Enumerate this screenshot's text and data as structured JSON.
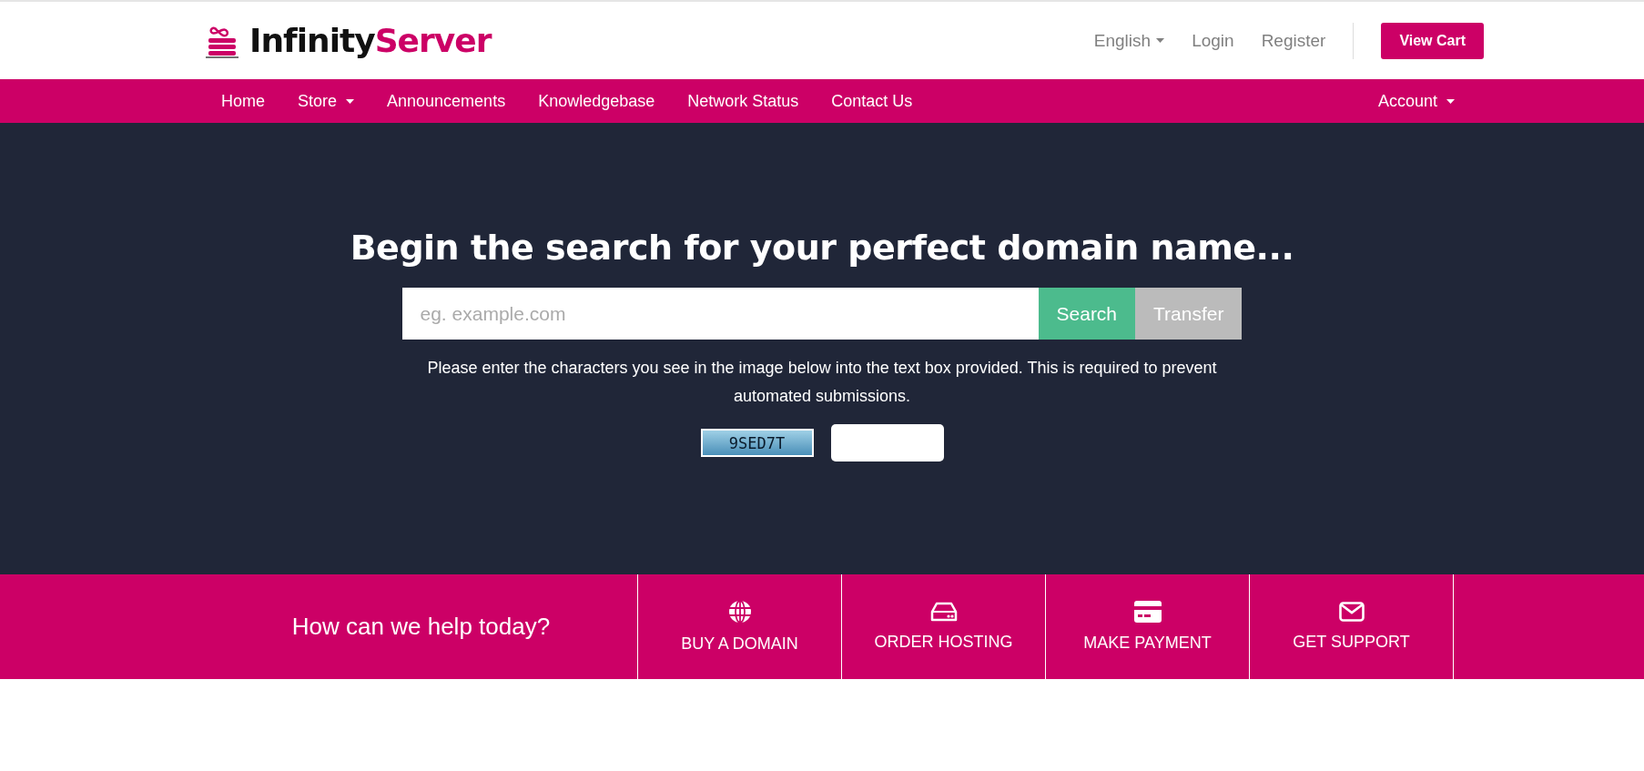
{
  "header": {
    "logo": {
      "first": "Infinity",
      "second": "Server"
    },
    "links": [
      {
        "label": "English",
        "dropdown": true
      },
      {
        "label": "Login",
        "dropdown": false
      },
      {
        "label": "Register",
        "dropdown": false
      }
    ],
    "cart_button": "View Cart"
  },
  "nav": {
    "items": [
      {
        "label": "Home",
        "dropdown": false
      },
      {
        "label": "Store",
        "dropdown": true
      },
      {
        "label": "Announcements",
        "dropdown": false
      },
      {
        "label": "Knowledgebase",
        "dropdown": false
      },
      {
        "label": "Network Status",
        "dropdown": false
      },
      {
        "label": "Contact Us",
        "dropdown": false
      }
    ],
    "account": {
      "label": "Account",
      "dropdown": true
    }
  },
  "hero": {
    "title": "Begin the search for your perfect domain name...",
    "search": {
      "placeholder": "eg. example.com"
    },
    "buttons": [
      {
        "label": "Search",
        "kind": "primary"
      },
      {
        "label": "Transfer",
        "kind": "secondary"
      }
    ],
    "captcha_note": "Please enter the characters you see in the image below into the text box provided. This is required to prevent automated submissions.",
    "captcha_code": "9SED7T"
  },
  "help": {
    "title": "How can we help today?",
    "actions": [
      {
        "label": "BUY A DOMAIN",
        "kind": "globe"
      },
      {
        "label": "ORDER HOSTING",
        "kind": "drive"
      },
      {
        "label": "MAKE PAYMENT",
        "kind": "card"
      },
      {
        "label": "GET SUPPORT",
        "kind": "mail"
      }
    ]
  }
}
